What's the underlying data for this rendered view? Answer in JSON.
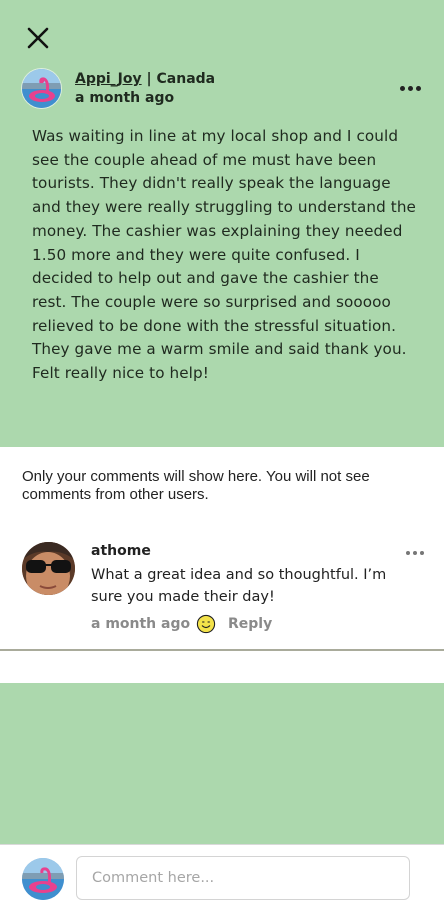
{
  "post": {
    "author": {
      "username": "Appi_Joy",
      "location": "Canada",
      "separator": "|"
    },
    "time": "a month ago",
    "body": "Was waiting in line at my local shop and I could see the couple ahead of me must have been tourists.  They didn't really speak the language and they were really struggling to understand the money.  The cashier was explaining they needed 1.50 more and they were quite confused.  I decided to help out and gave the cashier the rest.   The couple were so surprised and sooooo relieved to be done with the stressful situation.   They gave me a warm smile and said thank you.  Felt really nice to help!"
  },
  "notice": "Only your comments will show here. You will not see comments from other users.",
  "comments": [
    {
      "user": "athome",
      "text": "What a great idea and so thoughtful. I’m sure you made their day!",
      "time": "a month ago",
      "reply_label": "Reply"
    }
  ],
  "composer": {
    "placeholder": "Comment here..."
  },
  "colors": {
    "post_bg": "#acd8ad",
    "meta_gray": "#8a8a8a",
    "divider": "#a9ab9b"
  },
  "icons": {
    "close": "close-icon",
    "more": "more-options-icon",
    "emoji": "smiley-emoji-icon"
  }
}
